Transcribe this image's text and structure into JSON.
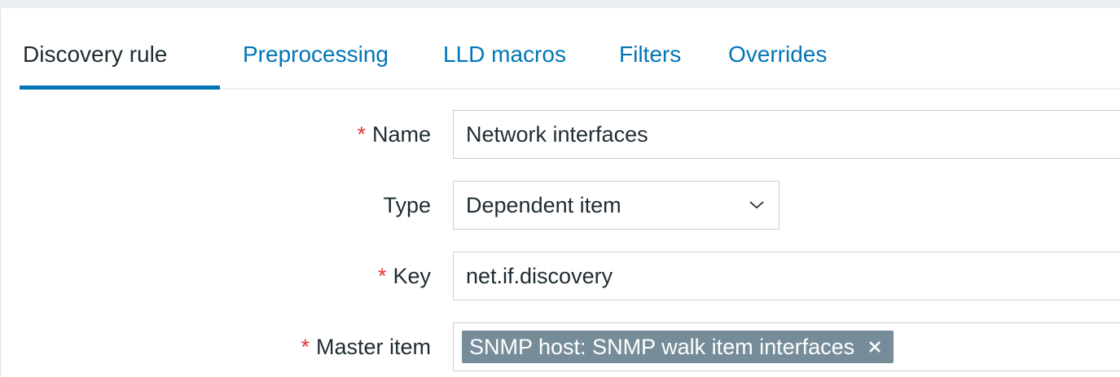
{
  "tabs": [
    {
      "label": "Discovery rule",
      "active": true
    },
    {
      "label": "Preprocessing",
      "active": false
    },
    {
      "label": "LLD macros",
      "active": false
    },
    {
      "label": "Filters",
      "active": false
    },
    {
      "label": "Overrides",
      "active": false
    }
  ],
  "form": {
    "required_marker": "*",
    "name": {
      "label": "Name",
      "value": "Network interfaces",
      "required": true
    },
    "type": {
      "label": "Type",
      "value": "Dependent item",
      "required": false
    },
    "key": {
      "label": "Key",
      "value": "net.if.discovery",
      "required": true
    },
    "master_item": {
      "label": "Master item",
      "tag": "SNMP host: SNMP walk item interfaces",
      "required": true
    }
  },
  "colors": {
    "link": "#0275b8",
    "text": "#1f2c33",
    "required": "#e33734",
    "tag_bg": "#768d99"
  }
}
